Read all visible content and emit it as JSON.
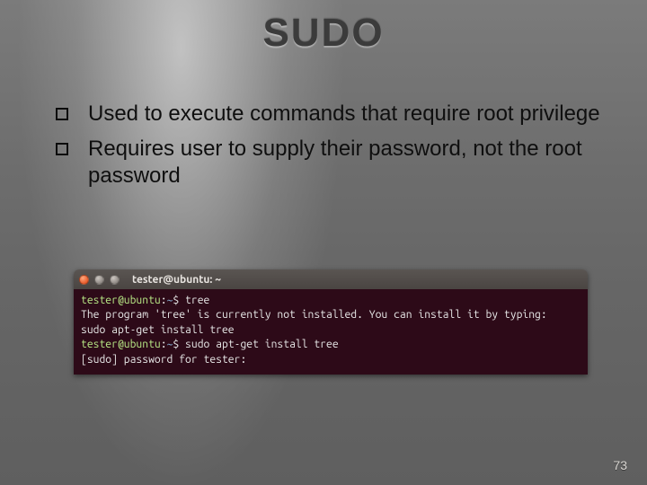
{
  "title": "SUDO",
  "bullets": [
    "Used to execute commands that require root privilege",
    "Requires user to supply their password, not the root password"
  ],
  "terminal": {
    "window_title": "tester@ubuntu: ~",
    "user": "tester",
    "host": "ubuntu",
    "path_display": "~",
    "lines": {
      "l0": {
        "prompt_user": "tester@ubuntu",
        "prompt_path": "~",
        "prompt_suffix": "$",
        "cmd": "tree"
      },
      "l1": "The program 'tree' is currently not installed. You can install it by typing:",
      "l2": "sudo apt-get install tree",
      "l3": {
        "prompt_user": "tester@ubuntu",
        "prompt_path": "~",
        "prompt_suffix": "$",
        "cmd": "sudo apt-get install tree"
      },
      "l4": "[sudo] password for tester:"
    }
  },
  "page_number": "73"
}
